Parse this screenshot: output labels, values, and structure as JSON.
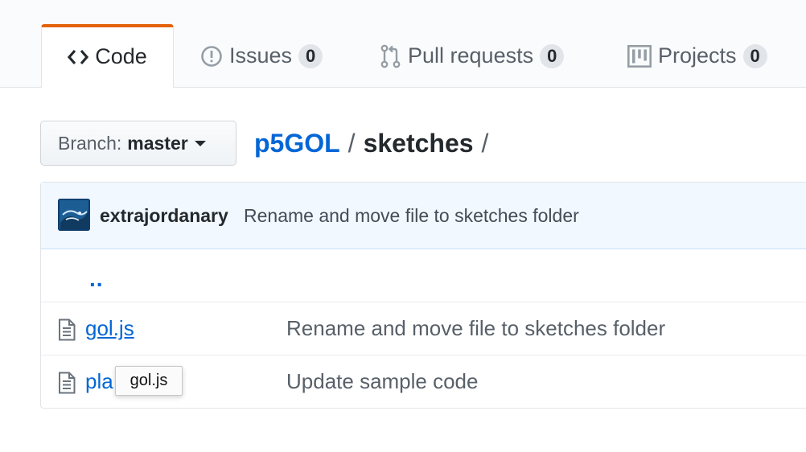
{
  "colors": {
    "link": "#0366d6",
    "selected_tab_accent": "#e36209",
    "commit_bg": "#f1f8ff"
  },
  "tabs": [
    {
      "label": "Code",
      "icon": "code-icon",
      "selected": true
    },
    {
      "label": "Issues",
      "count": "0",
      "icon": "issue-opened-icon"
    },
    {
      "label": "Pull requests",
      "count": "0",
      "icon": "git-pull-request-icon"
    },
    {
      "label": "Projects",
      "count": "0",
      "icon": "project-icon"
    }
  ],
  "branch": {
    "prefix": "Branch:",
    "name": "master"
  },
  "breadcrumb": {
    "repo": "p5GOL",
    "separator": "/",
    "folder": "sketches",
    "trailing": "/"
  },
  "commit": {
    "author": "extrajordanary",
    "message": "Rename and move file to sketches folder"
  },
  "files": {
    "parent": "..",
    "rows": [
      {
        "name": "gol.js",
        "message": "Rename and move file to sketches folder",
        "icon": "file-icon"
      },
      {
        "name": "pla",
        "message": "Update sample code",
        "icon": "file-icon"
      }
    ]
  },
  "tooltip": {
    "text": "gol.js"
  }
}
